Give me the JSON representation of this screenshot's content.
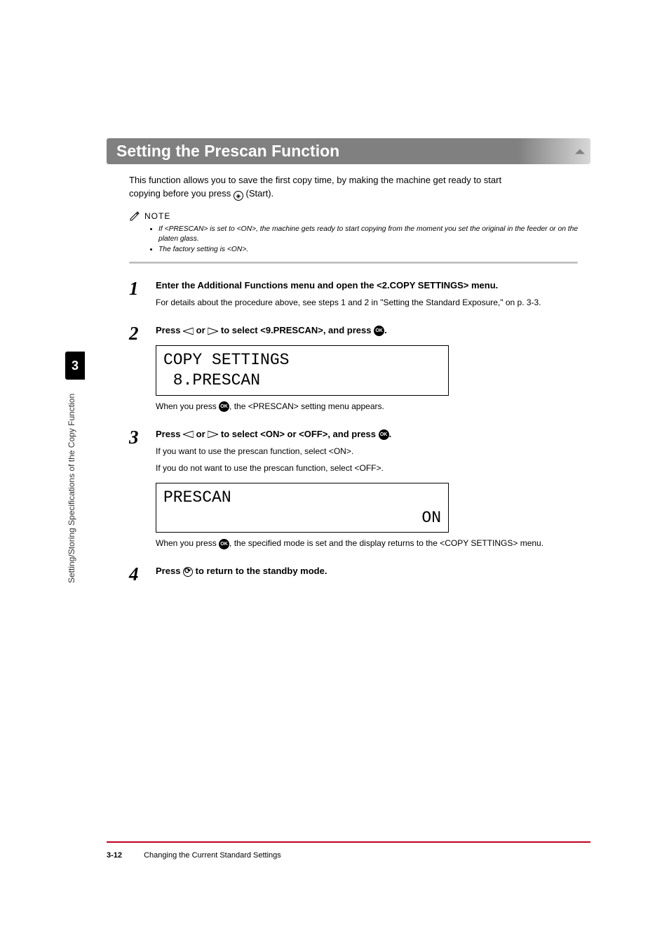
{
  "sidebar": {
    "chapter_number": "3",
    "vertical_label": "Setting/Storing Specifications of the Copy Function"
  },
  "heading": "Setting the Prescan Function",
  "intro": {
    "line1": "This function allows you to save the first copy time, by making the machine get ready to start",
    "line2_a": "copying before you press ",
    "line2_b": " (Start)."
  },
  "note": {
    "label": "NOTE",
    "bullets": [
      "If <PRESCAN> is set to <ON>, the machine gets ready to start copying from the moment you set the original in the feeder or on the platen glass.",
      "The factory setting is <ON>."
    ]
  },
  "steps": {
    "s1": {
      "num": "1",
      "instr": "Enter the Additional Functions menu and open the <2.COPY SETTINGS> menu.",
      "detail": "For details about the procedure above, see steps 1 and 2 in \"Setting the Standard Exposure,\" on p. 3-3."
    },
    "s2": {
      "num": "2",
      "instr_a": "Press ",
      "instr_b": " or ",
      "instr_c": " to select <9.PRESCAN>, and press ",
      "instr_d": ".",
      "lcd_line1": "COPY SETTINGS",
      "lcd_line2": " 8.PRESCAN",
      "after_a": "When you press ",
      "after_b": ", the <PRESCAN> setting menu appears."
    },
    "s3": {
      "num": "3",
      "instr_a": "Press ",
      "instr_b": " or ",
      "instr_c": " to select <ON> or <OFF>, and press ",
      "instr_d": ".",
      "detail1": "If you want to use the prescan function, select <ON>.",
      "detail2": "If you do not want to use the prescan function, select <OFF>.",
      "lcd_left": "PRESCAN",
      "lcd_right": "ON",
      "after_a": "When you press ",
      "after_b": ", the specified mode is set and the display returns to the <COPY SETTINGS> menu."
    },
    "s4": {
      "num": "4",
      "instr_a": "Press ",
      "instr_b": " to return to the standby mode."
    }
  },
  "footer": {
    "page": "3-12",
    "title": "Changing the Current Standard Settings"
  },
  "icons": {
    "ok": "OK"
  }
}
